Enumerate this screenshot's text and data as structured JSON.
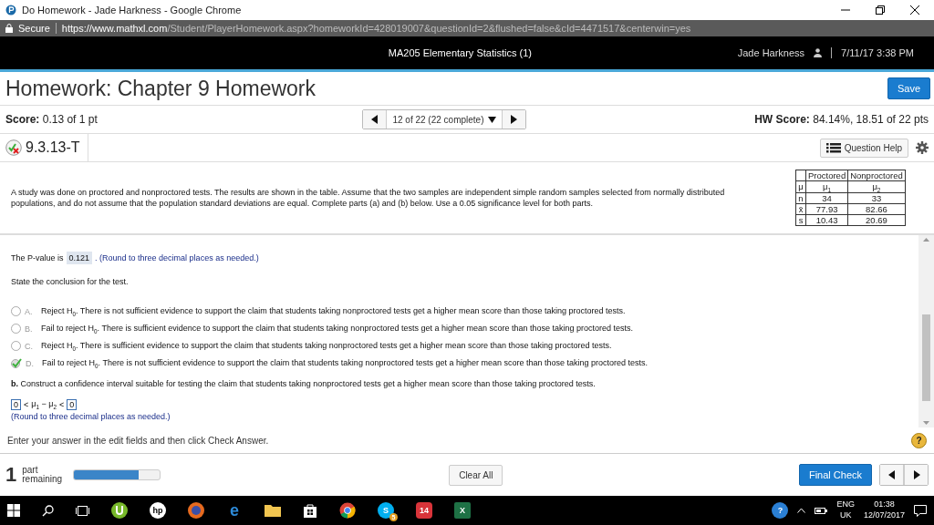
{
  "browser": {
    "title": "Do Homework - Jade Harkness - Google Chrome",
    "secure": "Secure",
    "url_host": "https://www.mathxl.com",
    "url_path": "/Student/PlayerHomework.aspx?homeworkId=428019007&questionId=2&flushed=false&cId=4471517&centerwin=yes"
  },
  "header": {
    "course": "MA205 Elementary Statistics (1)",
    "user": "Jade Harkness",
    "datetime": "7/11/17 3:38 PM"
  },
  "homework_title": "Homework: Chapter 9 Homework",
  "save": "Save",
  "score": {
    "label": "Score:",
    "value": "0.13 of 1 pt"
  },
  "pager": "12 of 22 (22 complete)",
  "hw_score": {
    "label": "HW Score:",
    "value": "84.14%, 18.51 of 22 pts"
  },
  "question_id": "9.3.13-T",
  "question_help": "Question Help",
  "problem": "A study was done on proctored and nonproctored tests. The results are shown in the table. Assume that the two samples are independent simple random samples selected from normally distributed populations, and do not assume that the population standard deviations are equal. Complete parts (a) and (b) below. Use a 0.05 significance level for both parts.",
  "data_table": {
    "columns": [
      "",
      "Proctored",
      "Nonproctored"
    ],
    "rows": [
      [
        "μ",
        "μ$_{1}$",
        "μ$_{2}$"
      ],
      [
        "n",
        "34",
        "33"
      ],
      [
        "x̄",
        "77.93",
        "82.66"
      ],
      [
        "s",
        "10.43",
        "20.69"
      ]
    ]
  },
  "pvalue": {
    "prefix": "The P-value is",
    "value": "0.121",
    "suffix": ". (Round to three decimal places as needed.)"
  },
  "conclusion_prompt": "State the conclusion for the test.",
  "options": [
    {
      "letter": "A.",
      "text": "Reject H$_{0}$. There is not sufficient evidence to support the claim that students taking nonproctored tests get a higher mean score than those taking proctored tests.",
      "selected": false
    },
    {
      "letter": "B.",
      "text": "Fail to reject H$_{0}$. There is sufficient evidence to support the claim that students taking nonproctored tests get a higher mean score than those taking proctored tests.",
      "selected": false
    },
    {
      "letter": "C.",
      "text": "Reject H$_{0}$. There is sufficient evidence to support the claim that students taking nonproctored tests get a higher mean score than those taking proctored tests.",
      "selected": false
    },
    {
      "letter": "D.",
      "text": "Fail to reject H$_{0}$. There is not sufficient evidence to support the claim that students taking nonproctored tests get a higher mean score than those taking proctored tests.",
      "selected": true
    }
  ],
  "part_b": "**b.** Construct a confidence interval suitable for testing the claim that students taking nonproctored tests get a higher mean score than those taking proctored tests.",
  "interval": {
    "lower": "0",
    "lt1": "<",
    "middle": "μ$_{1}$ − μ$_{2}$",
    "lt2": "<",
    "upper": "0",
    "note": "(Round to three decimal places as needed.)"
  },
  "instruction": "Enter your answer in the edit fields and then click Check Answer.",
  "help_glyph": "?",
  "parts": {
    "count": "1",
    "label_1": "part",
    "label_2": "remaining",
    "level": 0.75
  },
  "clear_all": "Clear All",
  "final_check": "Final Check",
  "taskbar": {
    "hp": "hp",
    "edge": "e",
    "skype": "S",
    "excel": "X",
    "tray_help": "?",
    "skype_badge": "5",
    "badge": "14",
    "lang": "ENG",
    "region": "UK",
    "time": "01:38",
    "date": "12/07/2017"
  }
}
